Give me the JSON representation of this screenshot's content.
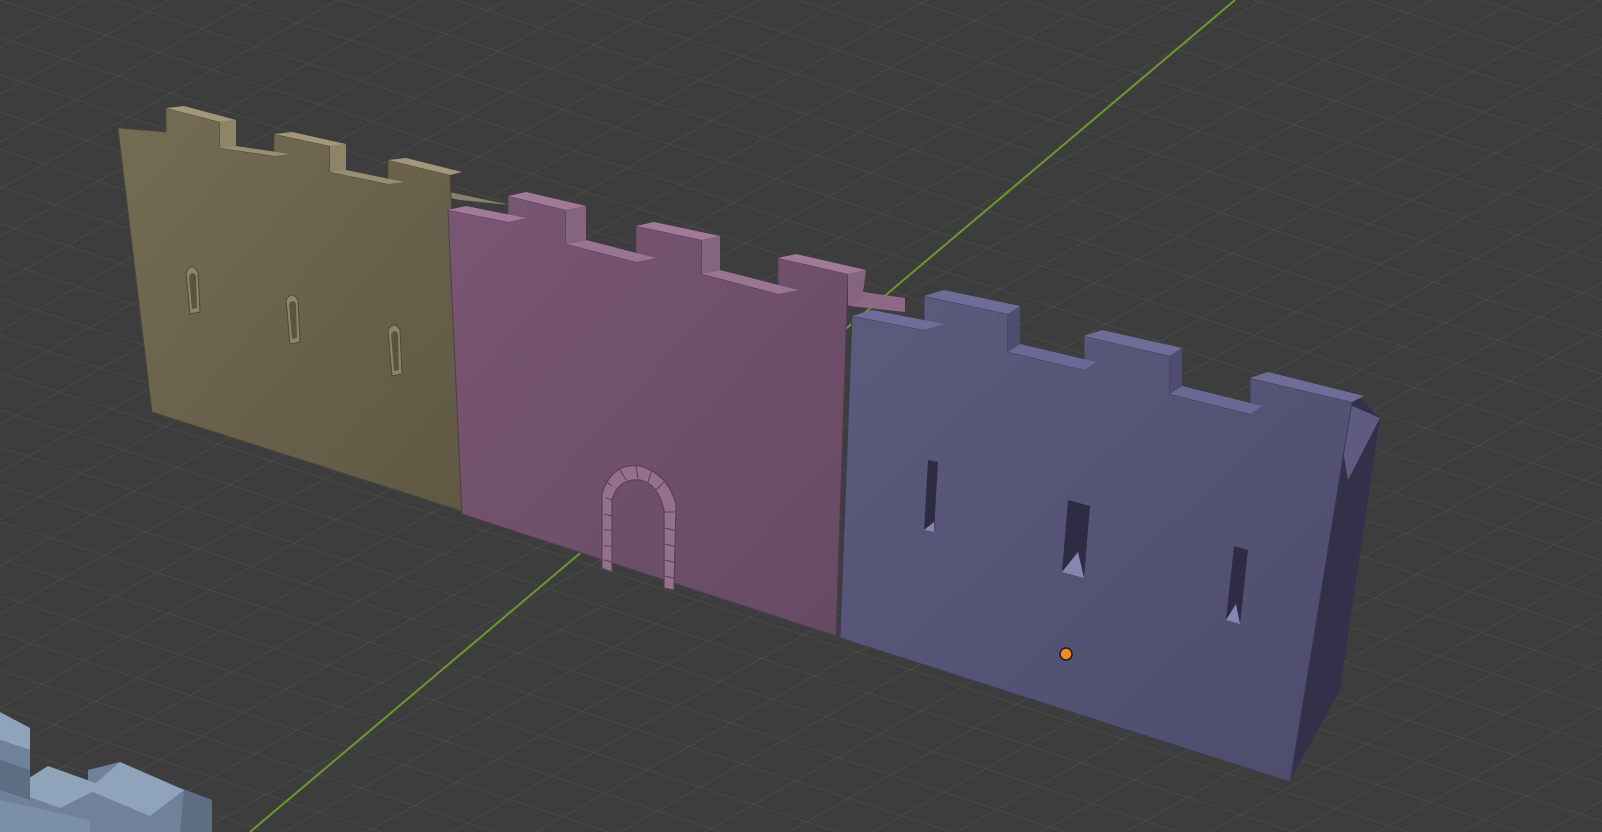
{
  "viewport": {
    "name": "3D Viewport",
    "background_color": "#3d3d3d",
    "grid_line_color": "#4a4a4a",
    "y_axis_color": "#6a9a2a"
  },
  "scene": {
    "objects": [
      {
        "name": "wall-segment-tan",
        "feature": "arrow-slit-windows",
        "color": "#6e6650"
      },
      {
        "name": "wall-segment-pink",
        "feature": "arched-doorway",
        "color": "#71526c"
      },
      {
        "name": "wall-segment-purple",
        "feature": "arrow-slits",
        "color": "#565577"
      },
      {
        "name": "wall-segment-blue-partial",
        "feature": "battlements",
        "color": "#7f93ab"
      }
    ],
    "origin_marker_color": "#f08c1e"
  }
}
